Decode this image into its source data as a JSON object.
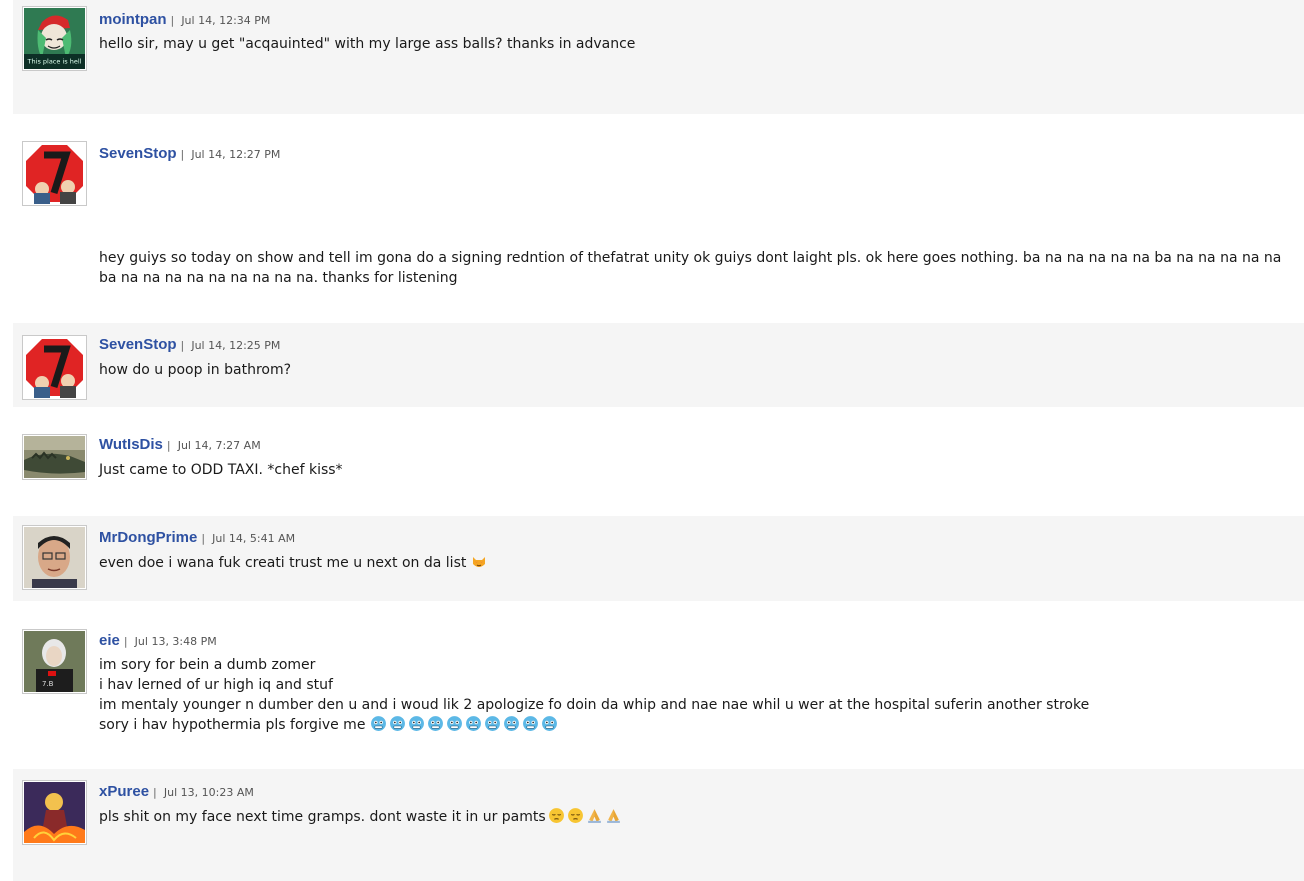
{
  "comments": [
    {
      "username": "mointpan",
      "sep": "|",
      "time": "Jul 14, 12:34 PM",
      "lines": [
        "hello sir, may u get \"acqauinted\" with my large ass balls? thanks in advance"
      ],
      "avatar_caption": "This place is hell"
    },
    {
      "username": "SevenStop",
      "sep": "|",
      "time": "Jul 14, 12:27 PM",
      "lines": [
        "hey guiys so today on show and tell im gona do a signing redntion of thefatrat unity ok guiys dont laight pls. ok here goes nothing. ba na na na na na ba na na na na na ba na na na na na na na na na. thanks for listening"
      ]
    },
    {
      "username": "SevenStop",
      "sep": "|",
      "time": "Jul 14, 12:25 PM",
      "lines": [
        "how do u poop in bathrom?"
      ]
    },
    {
      "username": "WutIsDis",
      "sep": "|",
      "time": "Jul 14, 7:27 AM",
      "lines": [
        "Just came to ODD TAXI. *chef kiss*"
      ]
    },
    {
      "username": "MrDongPrime",
      "sep": "|",
      "time": "Jul 14, 5:41 AM",
      "lines": [
        "even doe i wana fuk creati trust me u next on da list"
      ],
      "emoji": "heart-eyes-cat"
    },
    {
      "username": "eie",
      "sep": "|",
      "time": "Jul 13, 3:48 PM",
      "lines": [
        "im sory for bein a dumb zomer",
        "i hav lerned of ur high iq and stuf",
        "im mentaly younger n dumber den u and i woud lik 2 apologize fo doin da whip and nae nae whil u wer at the hospital suferin another stroke",
        "sory i hav hypothermia pls forgive me"
      ],
      "emoji": "cold-face",
      "emoji_count": 10
    },
    {
      "username": "xPuree",
      "sep": "|",
      "time": "Jul 13, 10:23 AM",
      "lines": [
        "pls shit on my face next time gramps. dont waste it in ur pamts"
      ],
      "emoji_sequence": [
        "pensive-face",
        "pensive-face",
        "folded-hands",
        "folded-hands"
      ]
    }
  ],
  "colors": {
    "username": "#2e51a2",
    "alt_row": "#f5f5f5"
  }
}
